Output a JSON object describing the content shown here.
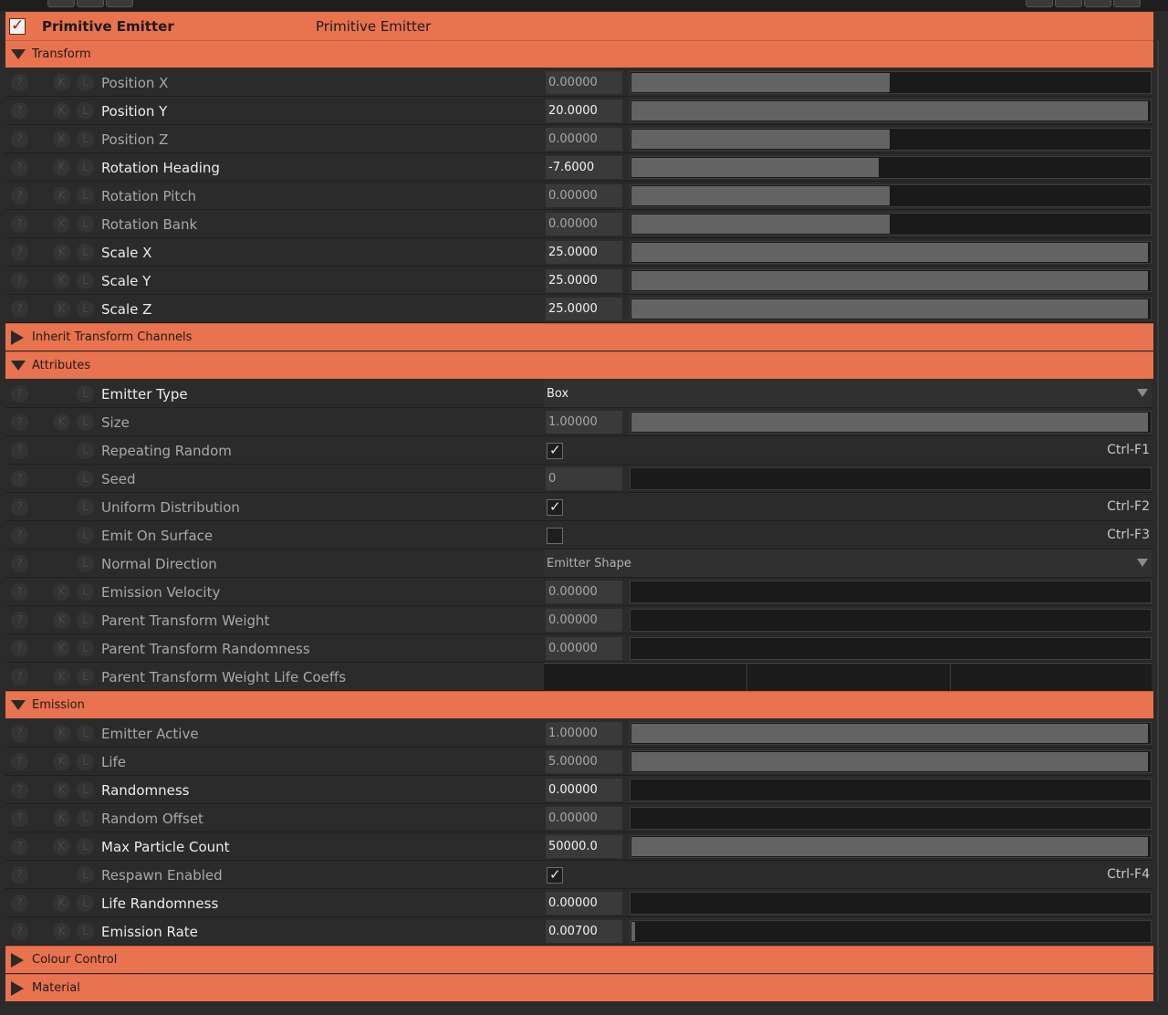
{
  "panel": {
    "enabled": true,
    "title": "Primitive Emitter",
    "subtitle": "Primitive Emitter"
  },
  "sections": [
    {
      "label": "Transform",
      "expanded": true,
      "rows": [
        {
          "name": "Position X",
          "value": "0.00000",
          "active": false,
          "k": true,
          "l": true,
          "kind": "slider",
          "fill": 0.5
        },
        {
          "name": "Position Y",
          "value": "20.0000",
          "active": true,
          "k": true,
          "l": true,
          "kind": "slider",
          "fill": 1.0
        },
        {
          "name": "Position Z",
          "value": "0.00000",
          "active": false,
          "k": true,
          "l": true,
          "kind": "slider",
          "fill": 0.5
        },
        {
          "name": "Rotation Heading",
          "value": "-7.6000",
          "active": true,
          "k": true,
          "l": true,
          "kind": "slider",
          "fill": 0.479
        },
        {
          "name": "Rotation Pitch",
          "value": "0.00000",
          "active": false,
          "k": true,
          "l": true,
          "kind": "slider",
          "fill": 0.5
        },
        {
          "name": "Rotation Bank",
          "value": "0.00000",
          "active": false,
          "k": true,
          "l": true,
          "kind": "slider",
          "fill": 0.5
        },
        {
          "name": "Scale X",
          "value": "25.0000",
          "active": true,
          "k": true,
          "l": true,
          "kind": "slider",
          "fill": 1.0
        },
        {
          "name": "Scale Y",
          "value": "25.0000",
          "active": true,
          "k": true,
          "l": true,
          "kind": "slider",
          "fill": 1.0
        },
        {
          "name": "Scale Z",
          "value": "25.0000",
          "active": true,
          "k": true,
          "l": true,
          "kind": "slider",
          "fill": 1.0
        }
      ]
    },
    {
      "label": "Inherit Transform Channels",
      "expanded": false,
      "rows": []
    },
    {
      "label": "Attributes",
      "expanded": true,
      "rows": [
        {
          "name": "Emitter Type",
          "value": "Box",
          "active": true,
          "k": false,
          "l": true,
          "kind": "select"
        },
        {
          "name": "Size",
          "value": "1.00000",
          "active": false,
          "k": true,
          "l": true,
          "kind": "slider",
          "fill": 1.0
        },
        {
          "name": "Repeating Random",
          "checked": true,
          "active": false,
          "k": false,
          "l": true,
          "kind": "check",
          "shortcut": "Ctrl-F1"
        },
        {
          "name": "Seed",
          "value": "0",
          "active": false,
          "k": false,
          "l": true,
          "kind": "slider",
          "fill": 0
        },
        {
          "name": "Uniform Distribution",
          "checked": true,
          "active": false,
          "k": false,
          "l": true,
          "kind": "check",
          "shortcut": "Ctrl-F2"
        },
        {
          "name": "Emit On Surface",
          "checked": false,
          "active": false,
          "k": false,
          "l": true,
          "kind": "check",
          "shortcut": "Ctrl-F3"
        },
        {
          "name": "Normal Direction",
          "value": "Emitter Shape",
          "active": false,
          "k": false,
          "l": true,
          "kind": "select"
        },
        {
          "name": "Emission Velocity",
          "value": "0.00000",
          "active": false,
          "k": true,
          "l": true,
          "kind": "slider",
          "fill": 0
        },
        {
          "name": "Parent Transform Weight",
          "value": "0.00000",
          "active": false,
          "k": true,
          "l": true,
          "kind": "slider",
          "fill": 0
        },
        {
          "name": "Parent Transform Randomness",
          "value": "0.00000",
          "active": false,
          "k": true,
          "l": true,
          "kind": "slider",
          "fill": 0
        },
        {
          "name": "Parent Transform Weight Life Coeffs",
          "active": false,
          "k": true,
          "l": true,
          "kind": "coeffs"
        }
      ]
    },
    {
      "label": "Emission",
      "expanded": true,
      "rows": [
        {
          "name": "Emitter Active",
          "value": "1.00000",
          "active": false,
          "k": true,
          "l": true,
          "kind": "slider",
          "fill": 1.0
        },
        {
          "name": "Life",
          "value": "5.00000",
          "active": false,
          "k": true,
          "l": true,
          "kind": "slider",
          "fill": 1.0
        },
        {
          "name": "Randomness",
          "value": "0.00000",
          "active": true,
          "k": true,
          "l": true,
          "kind": "slider",
          "fill": 0
        },
        {
          "name": "Random Offset",
          "value": "0.00000",
          "active": false,
          "k": true,
          "l": true,
          "kind": "slider",
          "fill": 0
        },
        {
          "name": "Max Particle Count",
          "value": "50000.0",
          "active": true,
          "k": true,
          "l": true,
          "kind": "slider",
          "fill": 1.0
        },
        {
          "name": "Respawn Enabled",
          "checked": true,
          "active": false,
          "k": false,
          "l": true,
          "kind": "check",
          "shortcut": "Ctrl-F4"
        },
        {
          "name": "Life Randomness",
          "value": "0.00000",
          "active": true,
          "k": true,
          "l": true,
          "kind": "slider",
          "fill": 0
        },
        {
          "name": "Emission Rate",
          "value": "0.00700",
          "active": true,
          "k": true,
          "l": true,
          "kind": "slider",
          "fill": 0.007
        }
      ]
    },
    {
      "label": "Colour Control",
      "expanded": false,
      "rows": []
    },
    {
      "label": "Material",
      "expanded": false,
      "rows": []
    }
  ],
  "icons": {
    "help": "?",
    "keyframe": "K",
    "link": "L",
    "check": "✓"
  },
  "colors": {
    "accent": "#e9734f",
    "panel": "#2b2b2b",
    "field": "#3a3a3a",
    "slider_fill": "#636363"
  }
}
